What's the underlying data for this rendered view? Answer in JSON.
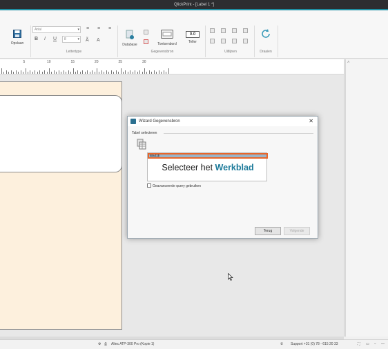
{
  "window": {
    "title": "QlickPrint - [Label 1 *]"
  },
  "ribbon": {
    "save_label": "Opslaan",
    "font": {
      "name": "Arial",
      "size": "8",
      "group_label": "Lettertype"
    },
    "datasource": {
      "database_label": "Database",
      "keyboard_label": "Toetsenbord",
      "counter_label": "Teller",
      "counter_value": "0.0",
      "group_label": "Gegevensbron"
    },
    "align": {
      "group_label": "Uitlijnen"
    },
    "rotate": {
      "group_label": "Draaien"
    }
  },
  "ruler": {
    "marks": [
      "5",
      "10",
      "15",
      "20",
      "25",
      "30"
    ]
  },
  "dialog": {
    "title": "Wizard Gegevensbron",
    "section_label": "Tabel selecteren",
    "selected_sheet": "Blad1$",
    "caption_prefix": "Selecteer het",
    "caption_highlight": "Werkblad",
    "advanced_query_label": "Geavanceerde query gebruiken",
    "back_button": "Terug",
    "next_button": "Volgende"
  },
  "statusbar": {
    "printer": "Altec ATP-300 Pro (Kopie 1)",
    "support": "Support +31 (0) 78 - 615 20 33"
  },
  "colors": {
    "accent": "#1c7a9a",
    "highlight_border": "#e8652a",
    "label_bg": "#fdf0dd"
  }
}
